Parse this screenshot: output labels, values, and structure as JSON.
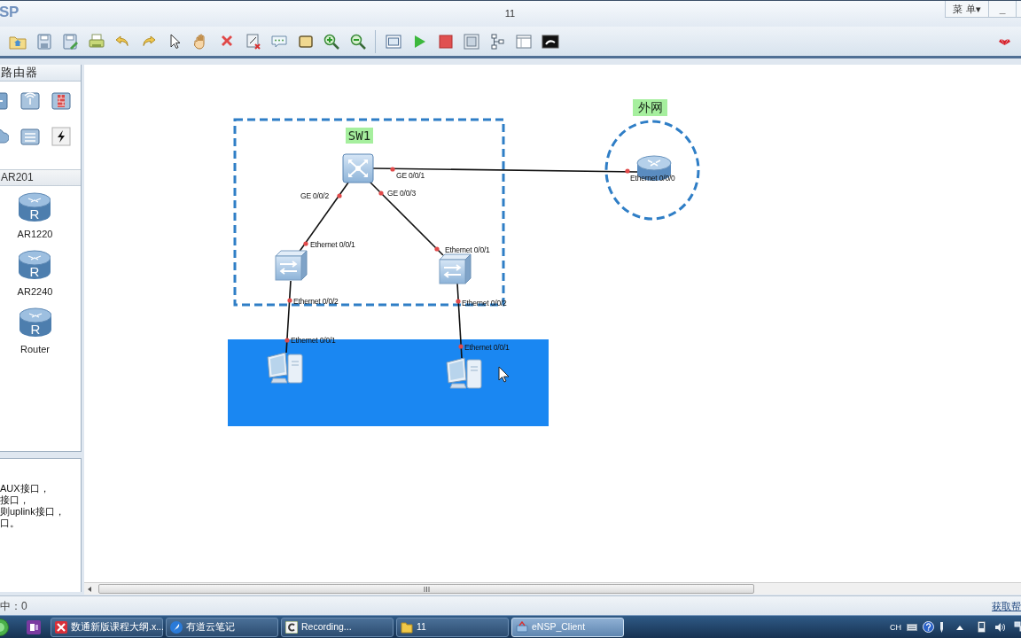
{
  "window": {
    "app_name": "SP",
    "title": "11",
    "menu_button": "菜 单▾",
    "minimize_button": "_"
  },
  "device_panel": {
    "header": "路由器",
    "group": "AR201",
    "devices": [
      {
        "label": "AR1220",
        "glyph": "R"
      },
      {
        "label": "AR2240",
        "glyph": "R"
      },
      {
        "label": "Router",
        "glyph": "R"
      }
    ]
  },
  "description": {
    "lines": [
      "AUX接口，",
      "接口，",
      "则uplink接口，",
      "口。"
    ]
  },
  "topology": {
    "areas": [
      {
        "kind": "rectangle",
        "label": "SW1"
      },
      {
        "kind": "circle",
        "label": "外网"
      },
      {
        "kind": "filled"
      }
    ],
    "nodes": [
      {
        "kind": "core-switch"
      },
      {
        "kind": "router"
      },
      {
        "kind": "switch"
      },
      {
        "kind": "switch"
      },
      {
        "kind": "pc"
      },
      {
        "kind": "pc"
      }
    ],
    "links": [
      {
        "ports": [
          "GE 0/0/1",
          "Ethernet 0/0/0"
        ]
      },
      {
        "ports": [
          "GE 0/0/2",
          "Ethernet 0/0/1"
        ]
      },
      {
        "ports": [
          "GE 0/0/3",
          "Ethernet 0/0/1"
        ]
      },
      {
        "ports": [
          "Ethernet 0/0/2",
          "Ethernet 0/0/1"
        ]
      },
      {
        "ports": [
          "Ethernet 0/0/2",
          "Ethernet 0/0/1"
        ]
      }
    ]
  },
  "status_bar": {
    "selection": "中：0",
    "help": "获取帮"
  },
  "taskbar": {
    "buttons": [
      {
        "label": "数通新版课程大纲.x...",
        "selected": false
      },
      {
        "label": "有道云笔记",
        "selected": false
      },
      {
        "label": "Recording...",
        "selected": false
      },
      {
        "label": "11",
        "selected": false
      },
      {
        "label": "eNSP_Client",
        "selected": true
      }
    ],
    "tray": {
      "language": "CH"
    }
  }
}
